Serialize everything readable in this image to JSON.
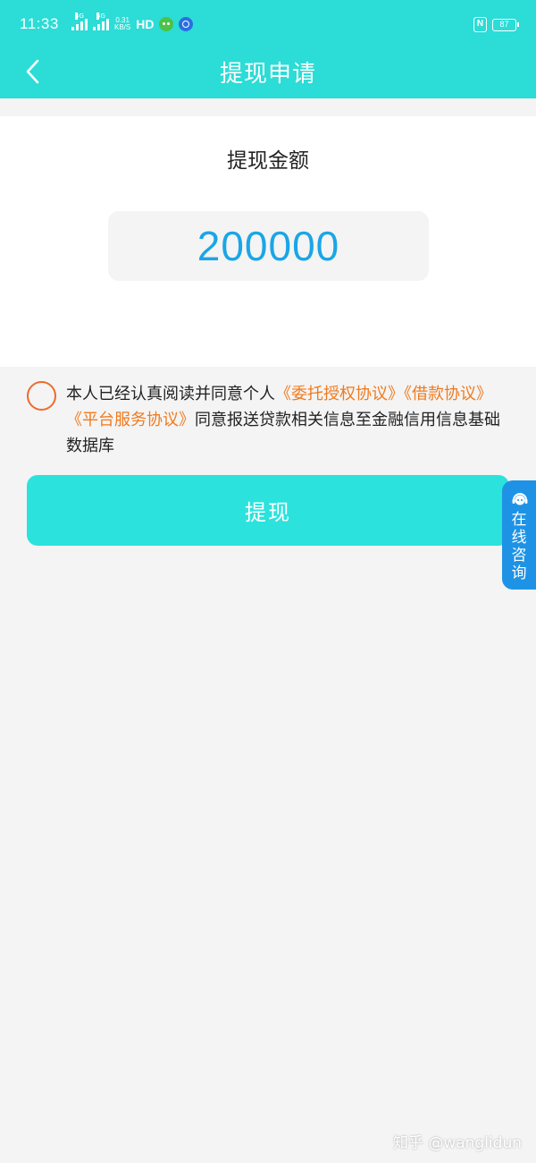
{
  "status_bar": {
    "time": "11:33",
    "network_speed_value": "0.31",
    "network_speed_unit": "KB/S",
    "hd_label": "HD",
    "battery": "87",
    "nfc_label": "N",
    "signal_label": "4G"
  },
  "header": {
    "title": "提现申请",
    "back_icon": "chevron-left-icon"
  },
  "amount": {
    "label": "提现金额",
    "value": "200000"
  },
  "agreement": {
    "prefix": "本人已经认真阅读并同意个人",
    "links": [
      "《委托授权协议》",
      "《借款协议》",
      "《平台服务协议》"
    ],
    "suffix": "同意报送贷款相关信息至金融信用信息基础数据库"
  },
  "actions": {
    "withdraw_label": "提现"
  },
  "consult": {
    "chars": [
      "在",
      "线",
      "咨",
      "询"
    ],
    "icon": "customer-service-icon"
  },
  "watermark": "知乎 @wanglidun",
  "colors": {
    "header": "#2cdcd6",
    "button": "#2ce2dc",
    "amount_text": "#1aa6e6",
    "link": "#f07a1e",
    "consult_tab": "#1e93e6"
  }
}
